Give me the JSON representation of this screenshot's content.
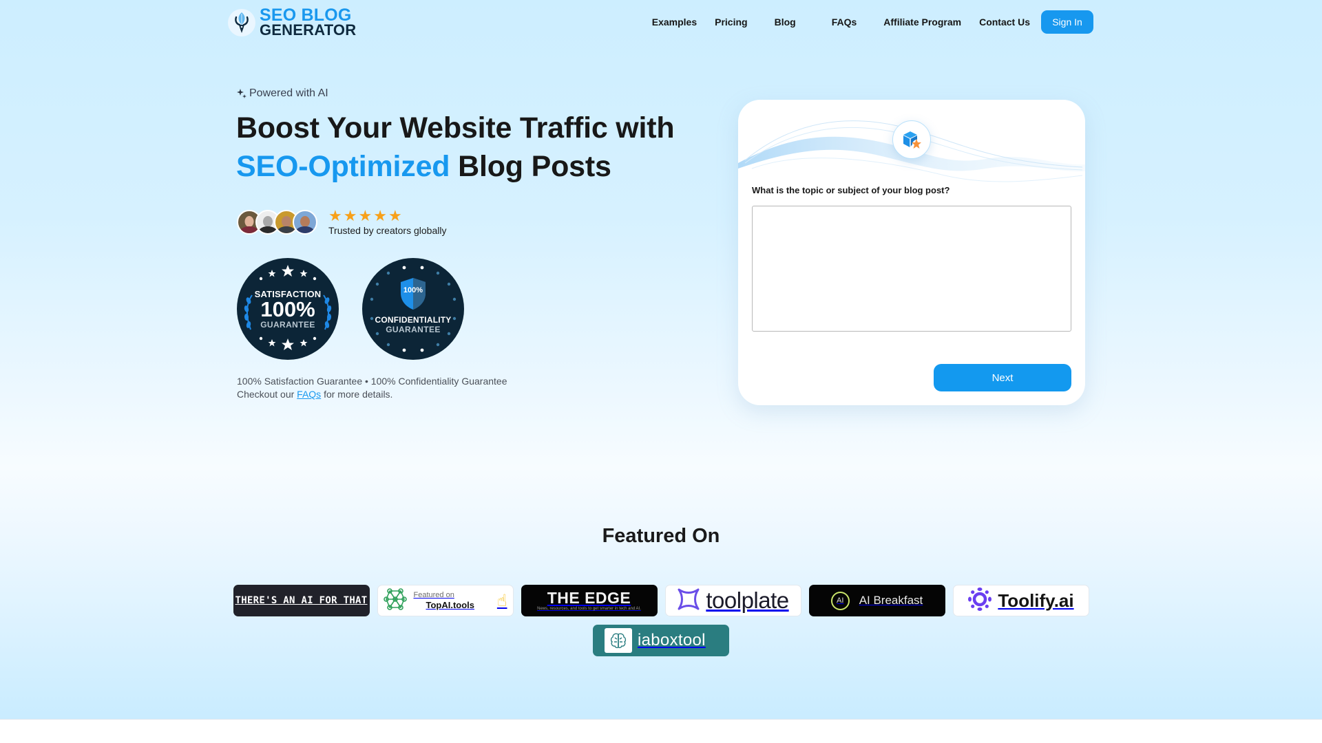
{
  "header": {
    "logo": {
      "line1": "SEO BLOG",
      "line2": "GENERATOR",
      "icon": "fountain-pen-feather-icon"
    },
    "nav": [
      {
        "label": "Examples"
      },
      {
        "label": "Pricing"
      },
      {
        "label": "Blog"
      },
      {
        "label": "FAQs"
      },
      {
        "label": "Affiliate Program"
      },
      {
        "label": "Contact Us"
      }
    ],
    "sign_in_label": "Sign In"
  },
  "hero": {
    "powered_label": "Powered with AI",
    "powered_icon": "sparkle-icon",
    "headline_line1": "Boost Your Website Traffic with",
    "headline_accent": "SEO-Optimized",
    "headline_rest": "Blog Posts",
    "rating": {
      "stars": 5,
      "max_stars": 5,
      "star_glyph": "★"
    },
    "trusted_label": "Trusted by creators globally",
    "avatars_count": 4,
    "badges": [
      {
        "top": "SATISFACTION",
        "big": "100%",
        "bottom": "GUARANTEE"
      },
      {
        "shield": "100%",
        "top": "CONFIDENTIALITY",
        "bottom": "GUARANTEE"
      }
    ],
    "guarantee_line": "100% Satisfaction Guarantee • 100% Confidentiality Guarantee",
    "checkout_prefix": "Checkout our",
    "checkout_link": "FAQs",
    "checkout_suffix": "for more details."
  },
  "card": {
    "icon": "box-star-icon",
    "question": "What is the topic or subject of your blog post?",
    "input_value": "",
    "input_placeholder": "",
    "next_label": "Next"
  },
  "featured": {
    "title": "Featured On",
    "logos": [
      {
        "name": "There's An AI For That",
        "text": "THERE'S AN AI FOR THAT"
      },
      {
        "name": "TopAI.tools",
        "line1": "Featured on",
        "line2": "TopAI.tools"
      },
      {
        "name": "The Edge",
        "line1": "THE EDGE",
        "line2": "News, resources, and tools to get smarter in tech and AI."
      },
      {
        "name": "toolplate",
        "text": "toolplate"
      },
      {
        "name": "AI Breakfast",
        "mark": "AI",
        "text": "AI Breakfast"
      },
      {
        "name": "Toolify.ai",
        "text": "Toolify.ai"
      },
      {
        "name": "iaboxtool",
        "text": "iaboxtool"
      }
    ]
  },
  "colors": {
    "accent": "#1798ef",
    "star": "#f7a019",
    "badge_bg": "#0c2537",
    "heading": "#181818"
  }
}
